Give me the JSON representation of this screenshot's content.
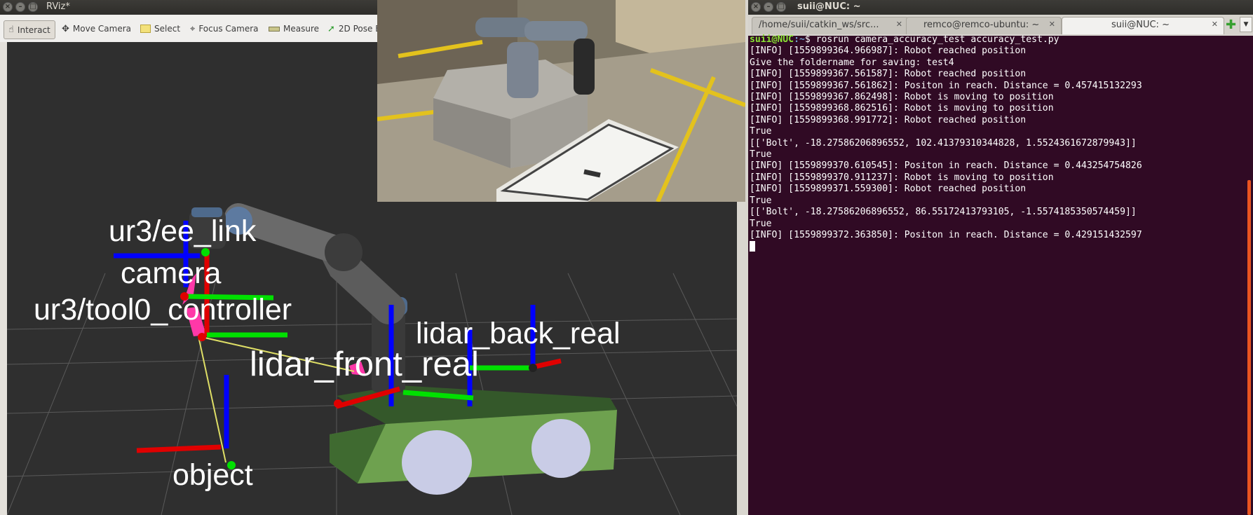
{
  "rviz": {
    "title": "RViz*",
    "toolbar": [
      {
        "label": "Interact",
        "icon": "hand-icon"
      },
      {
        "label": "Move Camera",
        "icon": "move-camera-icon"
      },
      {
        "label": "Select",
        "icon": "select-icon"
      },
      {
        "label": "Focus Camera",
        "icon": "focus-camera-icon"
      },
      {
        "label": "Measure",
        "icon": "measure-icon"
      },
      {
        "label": "2D Pose E",
        "icon": "pose-arrow-icon"
      }
    ],
    "frame_labels": [
      "ur3/ee_link",
      "camera",
      "ur3/tool0_controller",
      "lidar_back_real",
      "lidar_front_real",
      "object"
    ]
  },
  "terminal": {
    "title": "suii@NUC: ~",
    "tabs": [
      {
        "label": "/home/suii/catkin_ws/src...",
        "active": false
      },
      {
        "label": "remco@remco-ubuntu: ~",
        "active": false
      },
      {
        "label": "suii@NUC: ~",
        "active": true
      }
    ],
    "prompt_user": "suii@NUC",
    "prompt_path": ":~",
    "prompt_symbol": "$ ",
    "command": "rosrun camera_accuracy_test accuracy_test.py",
    "lines": [
      "[INFO] [1559899364.966987]: Robot reached position",
      "Give the foldername for saving: test4",
      "[INFO] [1559899367.561587]: Robot reached position",
      "[INFO] [1559899367.561862]: Positon in reach. Distance = 0.457415132293",
      "[INFO] [1559899367.862498]: Robot is moving to position",
      "[INFO] [1559899368.862516]: Robot is moving to position",
      "[INFO] [1559899368.991772]: Robot reached position",
      "True",
      "[['Bolt', -18.27586206896552, 102.41379310344828, 1.5524361672879943]]",
      "True",
      "[INFO] [1559899370.610545]: Positon in reach. Distance = 0.443254754826",
      "[INFO] [1559899370.911237]: Robot is moving to position",
      "[INFO] [1559899371.559300]: Robot reached position",
      "True",
      "[['Bolt', -18.27586206896552, 86.55172413793105, -1.5574185350574459]]",
      "True",
      "[INFO] [1559899372.363850]: Positon in reach. Distance = 0.429151432597"
    ]
  },
  "colors": {
    "terminal_bg": "#300a24",
    "prompt_user": "#8ae234",
    "prompt_path": "#729fcf",
    "viewport_bg": "#2f2f2f",
    "axis_x": "#e00000",
    "axis_y": "#00e000",
    "axis_z": "#0000ff"
  }
}
